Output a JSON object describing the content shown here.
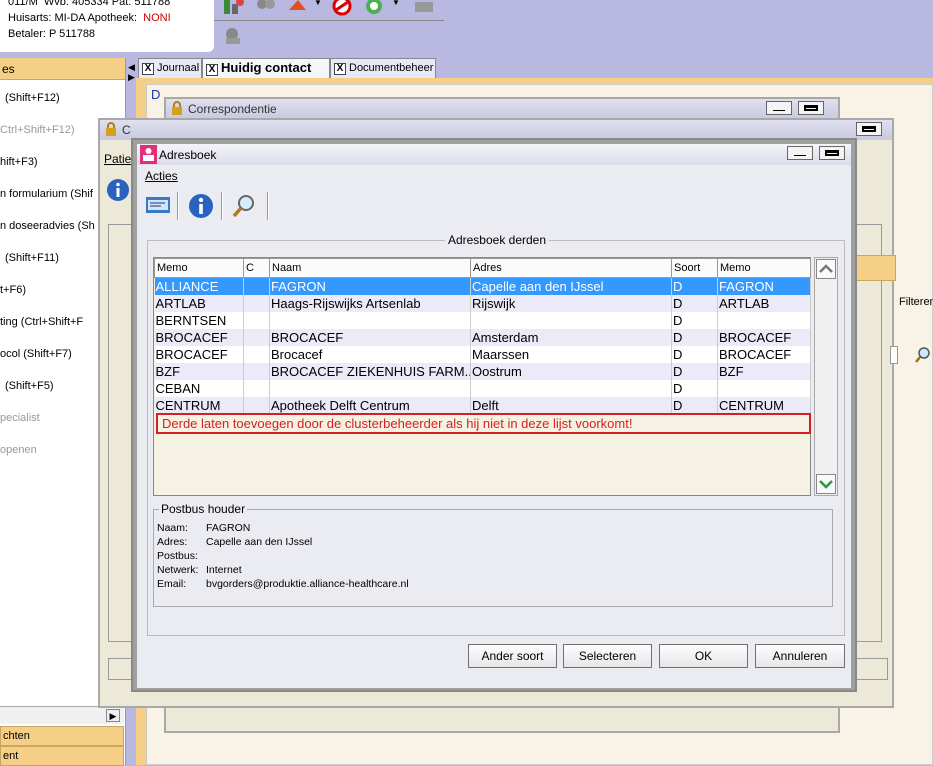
{
  "patient_info": {
    "line1_prefix": "011/M",
    "line1_rest": "Wvb: 405334 Pat: 511788",
    "line2_label": "Huisarts: MI-DA Apotheek:",
    "line2_value": "NONI",
    "line3": "Betaler: P 511788"
  },
  "sidebar": {
    "header": "es",
    "items": [
      {
        "label": "(Shift+F12)",
        "disabled": false
      },
      {
        "label": "Ctrl+Shift+F12)",
        "disabled": true
      },
      {
        "label": "hift+F3)",
        "disabled": false
      },
      {
        "label": "n formularium  (Shif",
        "disabled": false
      },
      {
        "label": "n doseeradvies  (Sh",
        "disabled": false
      },
      {
        "label": "(Shift+F11)",
        "disabled": false
      },
      {
        "label": "t+F6)",
        "disabled": false
      },
      {
        "label": "ting  (Ctrl+Shift+F",
        "disabled": false
      },
      {
        "label": "ocol  (Shift+F7)",
        "disabled": false
      },
      {
        "label": "(Shift+F5)",
        "disabled": false
      },
      {
        "label": "pecialist",
        "disabled": true
      },
      {
        "label": "openen",
        "disabled": true
      }
    ],
    "footer1": "chten",
    "footer2": "ent"
  },
  "tabs": [
    {
      "label": "Journaal",
      "active": false
    },
    {
      "label": "Huidig contact",
      "active": true
    },
    {
      "label": "Documentbeheer",
      "active": false
    }
  ],
  "background_windows": {
    "correspondentie_title": "Correspondentie",
    "second_title_fragment": "C",
    "patie_fragment": "Patie",
    "filter_fragment": "Filteren",
    "d_fragment": "D"
  },
  "dialog": {
    "title": "Adresboek",
    "menu": [
      "Acties"
    ],
    "toolbar_icons": [
      "card-icon",
      "info-icon",
      "search-icon"
    ],
    "group_title": "Adresboek derden",
    "columns": [
      "Memo",
      "C",
      "Naam",
      "Adres",
      "Soort",
      "Memo"
    ],
    "rows": [
      [
        "ALLIANCE",
        "",
        "FAGRON",
        "Capelle aan den IJssel",
        "D",
        "FAGRON"
      ],
      [
        "ARTLAB",
        "",
        "Haags-Rijswijks Artsenlab",
        "Rijswijk",
        "D",
        "ARTLAB"
      ],
      [
        "BERNTSEN",
        "",
        "",
        "",
        "D",
        ""
      ],
      [
        "BROCACEF",
        "",
        "BROCACEF",
        "Amsterdam",
        "D",
        "BROCACEF"
      ],
      [
        "BROCACEF",
        "",
        "Brocacef",
        "Maarssen",
        "D",
        "BROCACEF"
      ],
      [
        "BZF",
        "",
        "BROCACEF ZIEKENHUIS FARM...",
        "Oostrum",
        "D",
        "BZF"
      ],
      [
        "CEBAN",
        "",
        "",
        "",
        "D",
        ""
      ],
      [
        "CENTRUM",
        "",
        "Apotheek Delft Centrum",
        "Delft",
        "D",
        "CENTRUM"
      ]
    ],
    "selected_row": 0,
    "warning": "Derde laten toevoegen door de clusterbeheerder als hij niet in deze lijst voorkomt!",
    "postbus": {
      "title": "Postbus houder",
      "fields": [
        {
          "key": "Naam:",
          "value": "FAGRON"
        },
        {
          "key": "Adres:",
          "value": "Capelle aan den IJssel"
        },
        {
          "key": "Postbus:",
          "value": ""
        },
        {
          "key": "Netwerk:",
          "value": "Internet"
        },
        {
          "key": "Email:",
          "value": "bvgorders@produktie.alliance-healthcare.nl"
        }
      ]
    },
    "buttons": {
      "ander_soort": "Ander soort",
      "selecteren": "Selecteren",
      "ok": "OK",
      "annuleren": "Annuleren"
    }
  },
  "colors": {
    "background": "#b8b8e0",
    "sidebar_header": "#f5cf86",
    "selection": "#3399ff",
    "warning": "#d42020",
    "noni": "#d00000"
  }
}
